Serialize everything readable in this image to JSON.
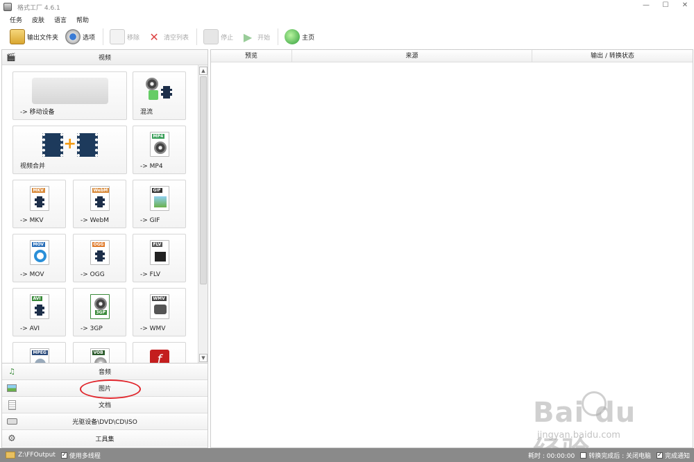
{
  "window": {
    "title": "格式工厂 4.6.1"
  },
  "menu": [
    "任务",
    "皮肤",
    "语言",
    "帮助"
  ],
  "toolbar": {
    "output_folder": "输出文件夹",
    "options": "选项",
    "remove": "移除",
    "clear_list": "清空列表",
    "stop": "停止",
    "start": "开始",
    "home": "主页"
  },
  "categories": {
    "video": "视频",
    "audio": "音频",
    "picture": "图片",
    "document": "文档",
    "disc": "光驱设备\\DVD\\CD\\ISO",
    "tools": "工具集"
  },
  "video_tiles": [
    {
      "label": "-> 移动设备"
    },
    {
      "label": "混流"
    },
    {
      "label": "视频合并"
    },
    {
      "label": "-> MP4",
      "tag": "MP4",
      "color": "#3b9f5a"
    },
    {
      "label": "-> MKV",
      "tag": "MKV",
      "color": "#d98a3a"
    },
    {
      "label": "-> WebM",
      "tag": "WebM",
      "color": "#d98a3a"
    },
    {
      "label": "-> GIF",
      "tag": "GIF",
      "color": "#333333"
    },
    {
      "label": "-> MOV",
      "tag": "MOV",
      "color": "#2a6fb8"
    },
    {
      "label": "-> OGG",
      "tag": "OGG",
      "color": "#e07a2a"
    },
    {
      "label": "-> FLV",
      "tag": "FLV",
      "color": "#555555"
    },
    {
      "label": "-> AVI",
      "tag": "AVI",
      "color": "#3a8a3a"
    },
    {
      "label": "-> 3GP",
      "tag": "3GP",
      "color": "#3a8a3a"
    },
    {
      "label": "-> WMV",
      "tag": "WMV",
      "color": "#444444"
    },
    {
      "label": "",
      "tag": "MPEG",
      "color": "#2a4a7a"
    },
    {
      "label": "",
      "tag": "VOB",
      "color": "#2a5a2a"
    },
    {
      "label": "",
      "tag": "",
      "color": "#cc2222"
    }
  ],
  "list_columns": {
    "preview": "预览",
    "source": "来源",
    "status": "输出 / 转换状态"
  },
  "statusbar": {
    "output_path": "Z:\\FFOutput",
    "multithread": "使用多线程",
    "elapsed": "耗时 : 00:00:00",
    "after_convert": "转换完成后 : 关闭电脑",
    "notify": "完成通知"
  },
  "watermark": {
    "main": "Bai du 经验",
    "sub": "jingyan.baidu.com"
  }
}
